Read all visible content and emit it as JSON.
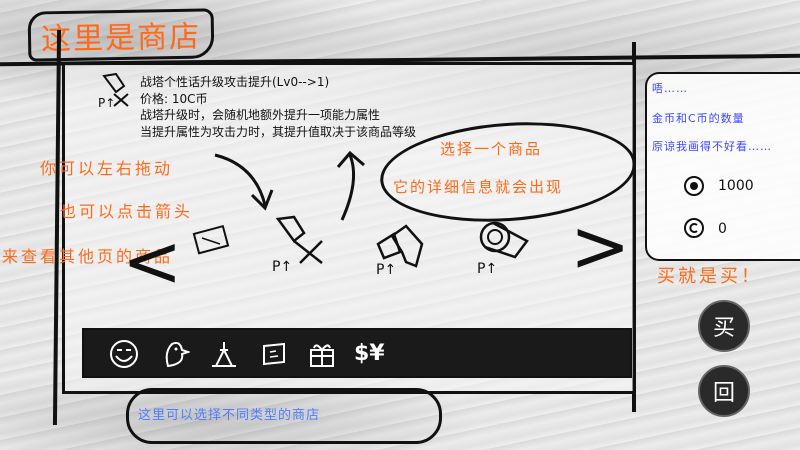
{
  "title": "这里是商店",
  "item": {
    "name": "战塔个性话升级攻击提升(Lv0-->1)",
    "price": "价格: 10C币",
    "desc1": "战塔升级时，会随机地额外提升一项能力属性",
    "desc2": "当提升属性为攻击力时，其提升值取决于该商品等级",
    "icon_label": "P↑"
  },
  "select_hint": {
    "line1": "选择一个商品",
    "line2": "它的详细信息就会出现"
  },
  "left_hints": [
    "你可以左右拖动",
    "也可以点击箭头",
    "来查看其他页的商品"
  ],
  "nav": {
    "prev": "<",
    "next": ">"
  },
  "products": [
    {
      "icon": "tower-flag-icon",
      "label": "P↑"
    },
    {
      "icon": "crystal-icon",
      "label": "P↑"
    },
    {
      "icon": "cannon-icon",
      "label": "P↑"
    }
  ],
  "tabs": [
    "smiley-face-icon",
    "chick-icon",
    "tower-icon",
    "scroll-icon",
    "gift-box-icon",
    "money-icon"
  ],
  "tab_money_label": "$¥",
  "bottom_hint": "这里可以选择不同类型的商店",
  "side": {
    "line1": "唔……",
    "line2": "金币和C币的数量",
    "line3": "原谅我画得不好看……",
    "gold_amount": "1000",
    "c_amount": "0"
  },
  "buy_hint": "买就是买！",
  "buy_label": "买",
  "back_label": "回"
}
